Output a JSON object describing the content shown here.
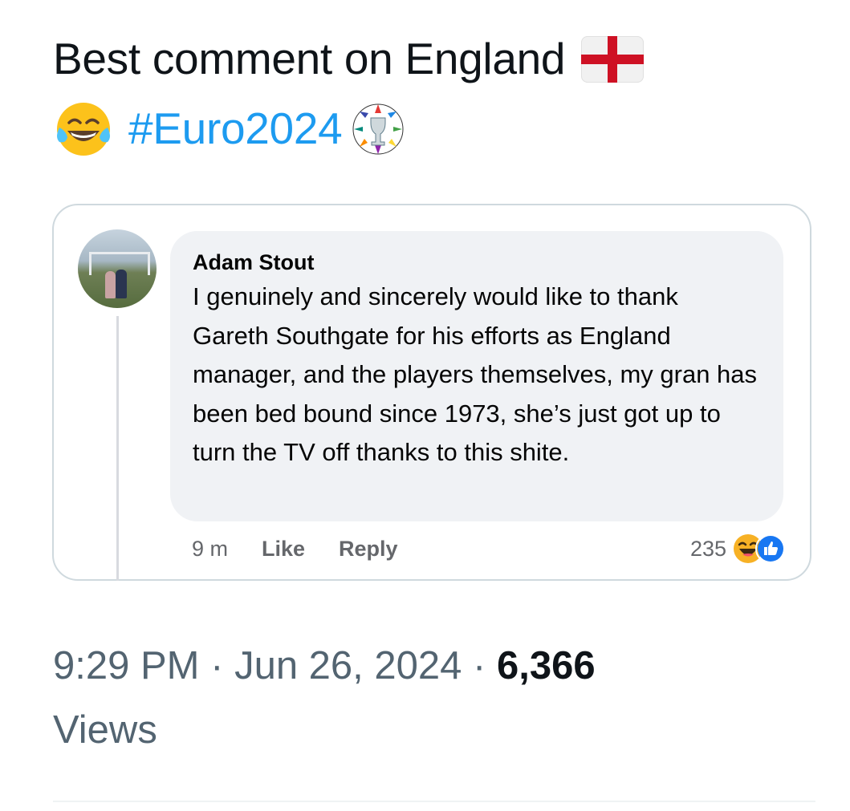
{
  "tweet": {
    "text_part1": "Best comment on England",
    "hashtag": "#Euro2024",
    "icons": [
      "england-flag-icon",
      "tears-of-joy-icon",
      "euro-trophy-icon"
    ]
  },
  "embedded_comment": {
    "author": "Adam Stout",
    "body": "I genuinely and sincerely would like to thank Gareth Southgate for his efforts as England manager, and the players themselves, my gran has been bed bound since 1973, she’s just got up to turn the TV off thanks to this shite.",
    "time": "9 m",
    "like_label": "Like",
    "reply_label": "Reply",
    "reaction_count": "235",
    "reaction_icons": [
      "haha-icon",
      "like-icon"
    ]
  },
  "meta": {
    "time": "9:29 PM",
    "separator": "·",
    "date": "Jun 26, 2024",
    "views_count": "6,366",
    "views_label": "Views"
  },
  "colors": {
    "hashtag": "#1d9bf0",
    "meta_text": "#536471",
    "bubble_bg": "#f0f2f5",
    "card_border": "#cfd9de"
  }
}
